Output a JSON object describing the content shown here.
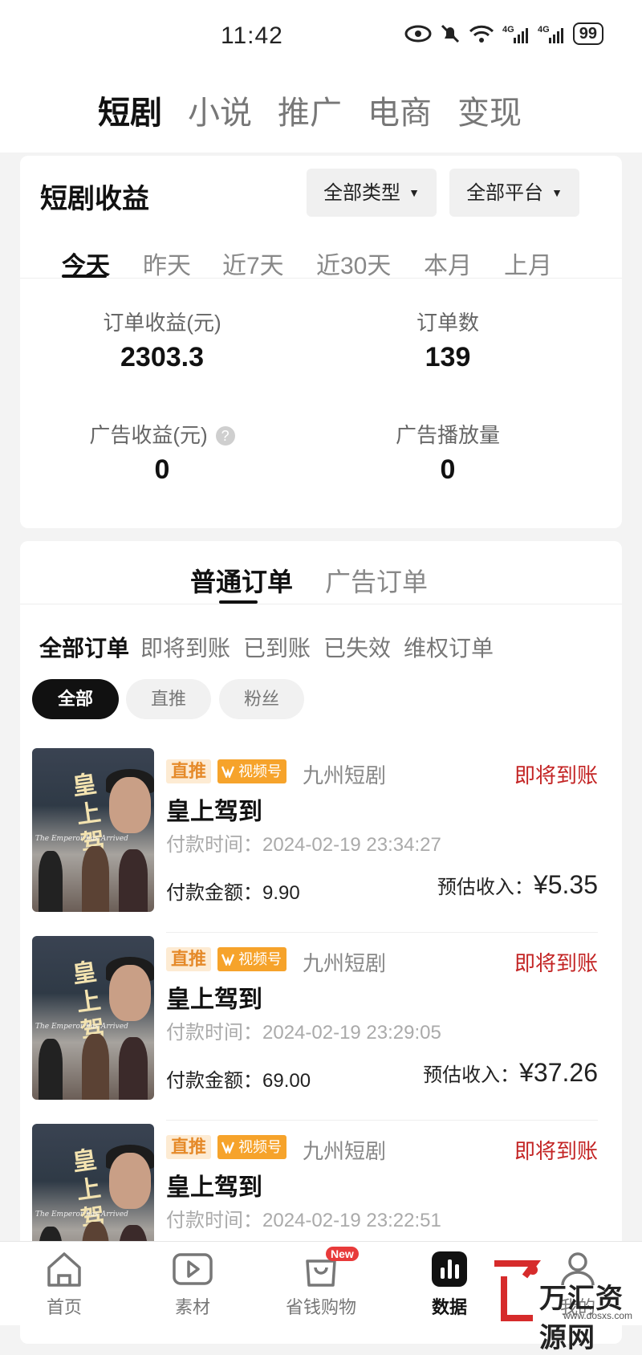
{
  "status_bar": {
    "time": "11:42",
    "battery": "99"
  },
  "top_tabs": [
    {
      "label": "短剧",
      "active": true
    },
    {
      "label": "小说",
      "active": false
    },
    {
      "label": "推广",
      "active": false
    },
    {
      "label": "电商",
      "active": false
    },
    {
      "label": "变现",
      "active": false
    }
  ],
  "earnings": {
    "title": "短剧收益",
    "type_filter": "全部类型",
    "platform_filter": "全部平台",
    "periods": [
      "今天",
      "昨天",
      "近7天",
      "近30天",
      "本月",
      "上月"
    ],
    "active_period": "今天",
    "stats": {
      "order_income_label": "订单收益(元)",
      "order_income_value": "2303.3",
      "order_count_label": "订单数",
      "order_count_value": "139",
      "ad_income_label": "广告收益(元)",
      "ad_income_value": "0",
      "ad_plays_label": "广告播放量",
      "ad_plays_value": "0"
    }
  },
  "orders": {
    "tabs": [
      "普通订单",
      "广告订单"
    ],
    "status_tabs": [
      "全部订单",
      "即将到账",
      "已到账",
      "已失效",
      "维权订单"
    ],
    "chips": [
      "全部",
      "直推",
      "粉丝"
    ],
    "items": [
      {
        "tag": "直推",
        "platform": "视频号",
        "source": "九州短剧",
        "status": "即将到账",
        "title": "皇上驾到",
        "time_label": "付款时间：",
        "time": "2024-02-19 23:34:27",
        "amount_label": "付款金额：",
        "amount": "9.90",
        "income_label": "预估收入：",
        "income": "¥5.35"
      },
      {
        "tag": "直推",
        "platform": "视频号",
        "source": "九州短剧",
        "status": "即将到账",
        "title": "皇上驾到",
        "time_label": "付款时间：",
        "time": "2024-02-19 23:29:05",
        "amount_label": "付款金额：",
        "amount": "69.00",
        "income_label": "预估收入：",
        "income": "¥37.26"
      },
      {
        "tag": "直推",
        "platform": "视频号",
        "source": "九州短剧",
        "status": "即将到账",
        "title": "皇上驾到",
        "time_label": "付款时间：",
        "time": "2024-02-19 23:22:51",
        "amount_label": "",
        "amount": "",
        "income_label": "",
        "income": ""
      }
    ],
    "poster": {
      "title": "皇上驾到",
      "subtitle": "The Emperor has Arrived"
    }
  },
  "bottom_nav": [
    {
      "label": "首页",
      "icon": "home-icon"
    },
    {
      "label": "素材",
      "icon": "play-icon"
    },
    {
      "label": "省钱购物",
      "icon": "shopping-bag-icon",
      "badge": "New"
    },
    {
      "label": "数据",
      "icon": "data-chart-icon",
      "active": true
    },
    {
      "label": "我的",
      "icon": "user-icon"
    }
  ],
  "watermark": {
    "text": "万汇资源网",
    "url": "www.dosxs.com"
  },
  "colors": {
    "accent": "#111111",
    "status_red": "#c32424",
    "tag_orange": "#f6a32b"
  }
}
